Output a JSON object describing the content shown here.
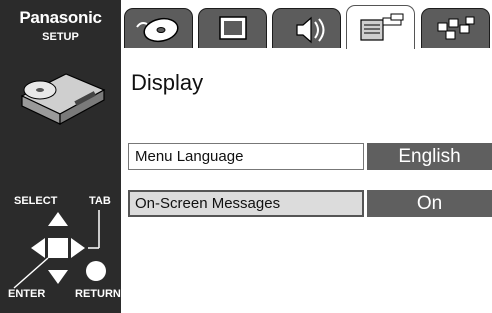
{
  "brand": {
    "name": "Panasonic",
    "mode": "SETUP"
  },
  "remote": {
    "select_label": "SELECT",
    "tab_label": "TAB",
    "enter_label": "ENTER",
    "return_label": "RETURN"
  },
  "tabs": [
    {
      "icon": "disc-icon"
    },
    {
      "icon": "tv-screen-icon"
    },
    {
      "icon": "speaker-icon"
    },
    {
      "icon": "display-settings-icon",
      "active": true
    },
    {
      "icon": "misc-settings-icon"
    }
  ],
  "page": {
    "title": "Display"
  },
  "settings": [
    {
      "label": "Menu Language",
      "value": "English"
    },
    {
      "label": "On-Screen Messages",
      "value": "On"
    }
  ],
  "colors": {
    "panel": "#2b2b2b",
    "tab": "#5c5c5c",
    "value_bg": "#5f5f5f",
    "highlight": "#dcdcdc"
  }
}
